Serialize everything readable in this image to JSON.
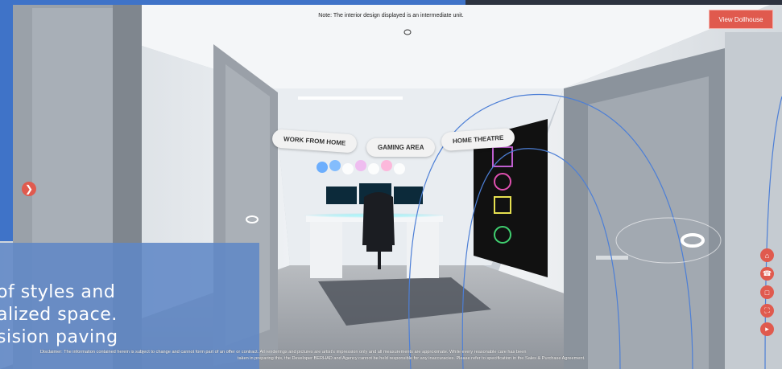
{
  "tour": {
    "note": "Note: The interior design displayed is an intermediate unit.",
    "view_dollhouse_label": "View Dollhouse",
    "prev_icon": "chevron-right-icon",
    "hotspots": [
      {
        "label": "WORK FROM HOME"
      },
      {
        "label": "GAMING AREA"
      },
      {
        "label": "HOME THEATRE"
      }
    ],
    "overlay_lines": [
      "of styles and",
      "alized  space.",
      "sision  paving"
    ],
    "side_icons": [
      "home-icon",
      "phone-icon",
      "floorplan-icon",
      "fullscreen-icon",
      "volume-icon"
    ],
    "disclaimer_line1": "Disclaimer: The information contained herein is subject to change and cannot form part of an offer or contract. All renderings and pictures are artist's impression only and all measurements are approximate. While every reasonable care has been",
    "disclaimer_line2": "taken in preparing this, the Developer BERHAD and Agency cannot be held responsible for any inaccuracies. Please refer to specification in the Sales & Purchase Agreement.",
    "colors": {
      "accent": "#e05a4e",
      "overlay_blue": "#6087c6",
      "top_bar": "#3f73c8"
    }
  }
}
